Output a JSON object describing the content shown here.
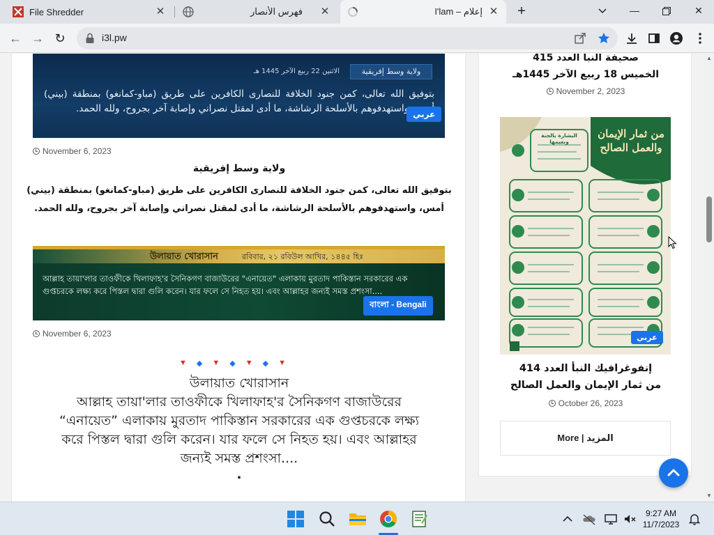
{
  "browser": {
    "tabs": [
      {
        "title": "File Shredder",
        "active": false
      },
      {
        "title": "فهرس الأنصار",
        "active": false
      },
      {
        "title": "I'lam – إعلام",
        "active": true
      }
    ],
    "url": "i3l.pw"
  },
  "main": {
    "post1": {
      "banner_label": "ولاية وسط إفريقية",
      "banner_date": "الاثنين 22 ربيع الآخر 1445 هـ",
      "banner_body": "بتوفيق الله تعالى، كمن جنود الخلافة للنصارى الكافرين على طريق (مباو-كمانغو) بمنطقة (بيني) أمس، واستهدفوهم بالأسلحة الرشاشة، ما أدى لمقتل نصراني وإصابة آخر بجروح، ولله الحمد.",
      "badge": "عربي",
      "date": "November 6, 2023",
      "title": "ولاية وسط إفريقية",
      "excerpt_line1": "بتوفيق الله تعالى، كمن جنود الخلافة للنصارى الكافرين على طريق (مباو-كمانغو) بمنطقة (بيني)",
      "excerpt_line2": "أمس، واستهدفوهم بالأسلحة الرشاشة، ما أدى لمقتل نصراني وإصابة آخر بجروح، ولله الحمد."
    },
    "post2": {
      "banner_label": "উলায়াত খোরাসান",
      "banner_date": "রবিবার, ২১ রবিউল আখির, ১৪৪৫ হিঃ",
      "banner_body_line1": "আল্লাহ তায়া'লার তাওফীকে খিলাফাহ'র সৈনিকগণ বাজাউরের \"এনায়েত\" এলাকায় মুরতাদ পাকিস্তান সরকারের এক",
      "banner_body_line2": "গুপ্তচরকে লক্ষ্য করে পিস্তল দ্বারা গুলি করেন। যার ফলে সে নিহত হয়। এবং আল্লাহর জন্যই সমস্ত প্রশংসা....",
      "badge": "বাংলা - Bengali",
      "date": "November 6, 2023",
      "title": "উলায়াত খোরাসান",
      "body_line1": "আল্লাহ তায়া'লার তাওফীকে খিলাফাহ'র সৈনিকগণ বাজাউরের",
      "body_line2": "“এনায়েত” এলাকায় মুরতাদ পাকিস্তান সরকারের এক গুপ্তচরকে লক্ষ্য",
      "body_line3": "করে পিস্তল দ্বারা গুলি করেন। যার ফলে সে নিহত হয়। এবং আল্লাহর",
      "body_line4": "জন্যই সমস্ত প্রশংসা....",
      "tail": "."
    }
  },
  "sidebar": {
    "item1": {
      "title_line1": "صحيفة النبأ العدد 415",
      "title_line2": "الخميس 18 ربيع الآخر 1445هـ",
      "date": "November 2, 2023"
    },
    "item2": {
      "image_title": "من ثمار الإيمان والعمل الصالح",
      "image_header": "البشارة بالجنة وبعيمها",
      "badge": "عربي",
      "title_line1": "إنفوغرافيك النبأ العدد 414",
      "title_line2": "من ثمار الإيمان والعمل الصالح",
      "date": "October 26, 2023"
    },
    "more_label": "More | المزيد"
  },
  "taskbar": {
    "time": "9:27 AM",
    "date": "11/7/2023"
  },
  "colors": {
    "accent": "#1a73e8",
    "marker_red": "#d93025",
    "marker_blue": "#1a73e8"
  }
}
